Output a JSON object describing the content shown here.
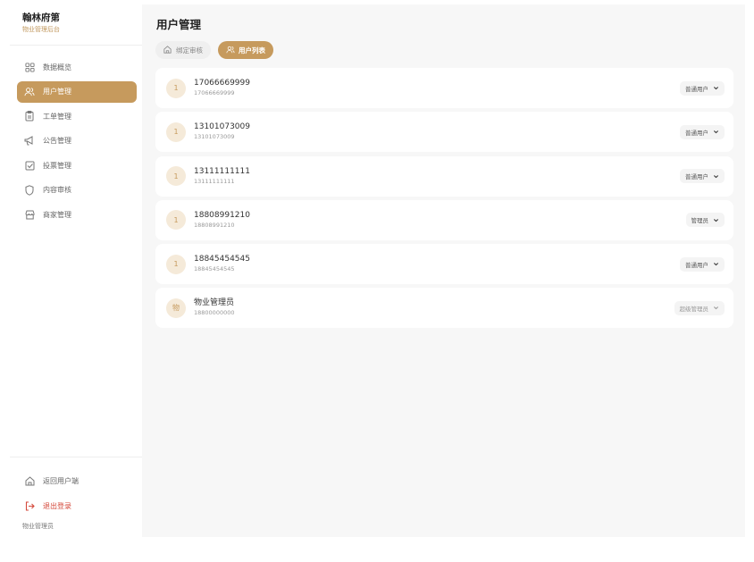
{
  "brand": {
    "title": "翰林府第",
    "subtitle": "物业管理后台"
  },
  "nav": [
    {
      "label": "数据概览",
      "icon": "dashboard-icon",
      "active": false
    },
    {
      "label": "用户管理",
      "icon": "users-icon",
      "active": true
    },
    {
      "label": "工单管理",
      "icon": "clipboard-icon",
      "active": false
    },
    {
      "label": "公告管理",
      "icon": "megaphone-icon",
      "active": false
    },
    {
      "label": "投票管理",
      "icon": "checkbox-icon",
      "active": false
    },
    {
      "label": "内容审核",
      "icon": "shield-icon",
      "active": false
    },
    {
      "label": "商家管理",
      "icon": "store-icon",
      "active": false
    }
  ],
  "bottom": {
    "back_label": "返回用户端",
    "logout_label": "退出登录",
    "role": "物业管理员"
  },
  "page": {
    "title": "用户管理"
  },
  "tabs": [
    {
      "label": "绑定审核",
      "icon": "home-icon",
      "active": false
    },
    {
      "label": "用户列表",
      "icon": "users-icon",
      "active": true
    }
  ],
  "users": [
    {
      "avatar": "1",
      "name": "17066669999",
      "phone": "17066669999",
      "role": "普通用户"
    },
    {
      "avatar": "1",
      "name": "13101073009",
      "phone": "13101073009",
      "role": "普通用户"
    },
    {
      "avatar": "1",
      "name": "13111111111",
      "phone": "13111111111",
      "role": "普通用户"
    },
    {
      "avatar": "1",
      "name": "18808991210",
      "phone": "18808991210",
      "role": "管理员"
    },
    {
      "avatar": "1",
      "name": "18845454545",
      "phone": "18845454545",
      "role": "普通用户"
    },
    {
      "avatar": "物",
      "name": "物业管理员",
      "phone": "18800000000",
      "role": "超级管理员"
    }
  ],
  "colors": {
    "accent": "#c69a5d",
    "danger": "#d4493b",
    "brand_sub": "#c0975c"
  }
}
